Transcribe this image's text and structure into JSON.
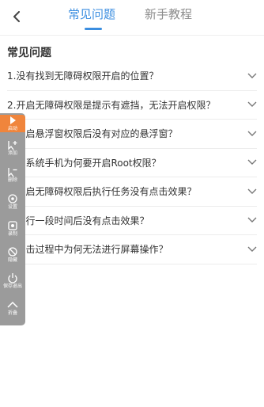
{
  "header": {
    "back_icon": "chevron-left-icon",
    "tabs": [
      {
        "label": "常见问题",
        "active": true
      },
      {
        "label": "新手教程",
        "active": false
      }
    ]
  },
  "section": {
    "title": "常见问题"
  },
  "faq": [
    "1.没有找到无障碍权限开启的位置？",
    "2.开启无障碍权限是提示有遮挡，无法开启权限？",
    "3.开启悬浮窗权限后没有对应的悬浮窗？",
    "4.低系统手机为何要开启Root权限？",
    "5.开启无障碍权限后执行任务没有点击效果？",
    "6.运行一段时间后没有点击效果？",
    "7.点击过程中为何无法进行屏幕操作？"
  ],
  "floating_panel": {
    "buttons": [
      {
        "label": "启动",
        "icon": "play-icon"
      },
      {
        "label": "添加",
        "icon": "add-tap-icon"
      },
      {
        "label": "删除",
        "icon": "remove-tap-icon"
      },
      {
        "label": "设置",
        "icon": "settings-icon"
      },
      {
        "label": "录制",
        "icon": "record-icon"
      },
      {
        "label": "隐藏",
        "icon": "hide-icon"
      },
      {
        "label": "保存退出",
        "icon": "power-icon"
      },
      {
        "label": "折叠",
        "icon": "chevron-up-icon"
      }
    ]
  },
  "colors": {
    "accent": "#3b8ee0",
    "start_button": "#f0853c",
    "panel": "#9b9b9b"
  }
}
